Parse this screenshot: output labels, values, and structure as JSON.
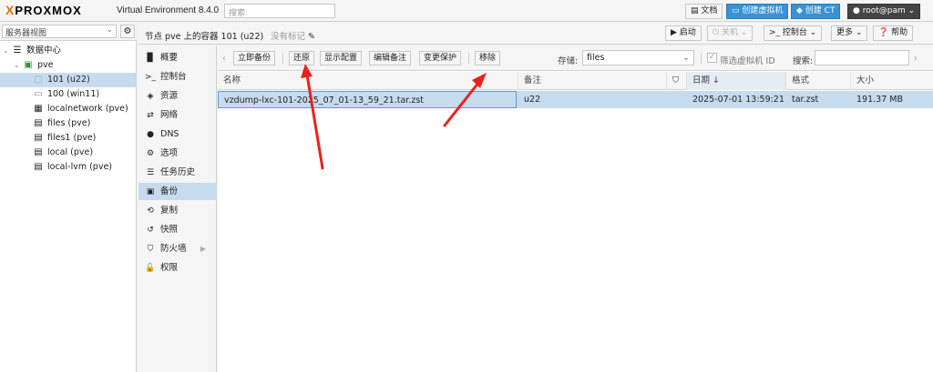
{
  "topbar": {
    "logo": "PROXMOX",
    "version": "Virtual Environment 8.4.0",
    "search_placeholder": "搜索",
    "docs": "文档",
    "create_vm": "创建虚拟机",
    "create_ct": "创建 CT",
    "user": "root@pam"
  },
  "sidebar": {
    "view": "服务器视图",
    "tree": [
      {
        "label": "数据中心",
        "icon": "datacenter-icon"
      },
      {
        "label": "pve",
        "icon": "node-icon"
      },
      {
        "label": "101 (u22)",
        "icon": "container-icon"
      },
      {
        "label": "100 (win11)",
        "icon": "vm-icon"
      },
      {
        "label": "localnetwork (pve)",
        "icon": "network-icon"
      },
      {
        "label": "files (pve)",
        "icon": "storage-icon"
      },
      {
        "label": "files1 (pve)",
        "icon": "storage-icon"
      },
      {
        "label": "local (pve)",
        "icon": "storage-icon"
      },
      {
        "label": "local-lvm (pve)",
        "icon": "storage-icon"
      }
    ]
  },
  "header": {
    "title": "节点 pve 上的容器 101 (u22)",
    "tag": "没有标记",
    "start": "启动",
    "shutdown": "关机",
    "console": "控制台",
    "more": "更多",
    "help": "帮助"
  },
  "menu": [
    {
      "label": "概要",
      "icon": "summary-icon"
    },
    {
      "label": "控制台",
      "icon": "console-icon"
    },
    {
      "label": "资源",
      "icon": "resources-icon"
    },
    {
      "label": "网络",
      "icon": "network-icon"
    },
    {
      "label": "DNS",
      "icon": "dns-icon"
    },
    {
      "label": "选项",
      "icon": "options-icon"
    },
    {
      "label": "任务历史",
      "icon": "task-history-icon"
    },
    {
      "label": "备份",
      "icon": "backup-icon"
    },
    {
      "label": "复制",
      "icon": "replication-icon"
    },
    {
      "label": "快照",
      "icon": "snapshot-icon"
    },
    {
      "label": "防火墙",
      "icon": "firewall-icon"
    },
    {
      "label": "权限",
      "icon": "permissions-icon"
    }
  ],
  "backup_toolbar": {
    "backup_now": "立即备份",
    "restore": "还原",
    "show_config": "显示配置",
    "edit_notes": "编辑备注",
    "change_protection": "变更保护",
    "remove": "移除",
    "storage_label": "存储:",
    "storage_value": "files",
    "filter_vmid": "筛选虚拟机 ID",
    "search_label": "搜索:"
  },
  "table": {
    "columns": [
      "名称",
      "备注",
      "",
      "日期 ↓",
      "格式",
      "大小"
    ],
    "rows": [
      {
        "name": "vzdump-lxc-101-2025_07_01-13_59_21.tar.zst",
        "notes": "u22",
        "protected": "",
        "date": "2025-07-01 13:59:21",
        "format": "tar.zst",
        "size": "191.37 MB"
      }
    ]
  },
  "colors": {
    "accent": "#3892d4",
    "selection": "#c7dbee",
    "arrow": "#e8221b",
    "logo_x": "#e57000"
  }
}
